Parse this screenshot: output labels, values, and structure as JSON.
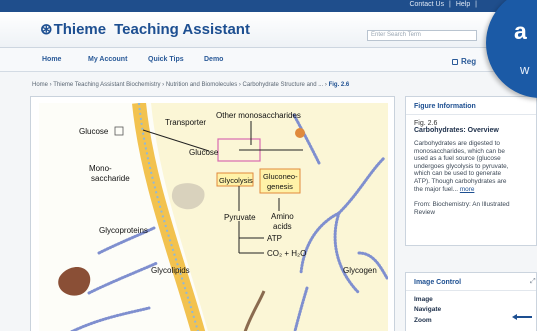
{
  "topbar": {
    "links": [
      "Contact Us",
      "|",
      "Help",
      "|"
    ]
  },
  "header": {
    "brand": "Thieme",
    "brand_icon": "thieme-logo-icon",
    "product": "Teaching Assistant",
    "search_placeholder": "Enter Search Term"
  },
  "nav": {
    "items": [
      "Home",
      "My Account",
      "Quick Tips",
      "Demo"
    ],
    "register": "Reg"
  },
  "breadcrumb": {
    "path": "Home › Thieme Teaching Assistant Biochemistry › Nutrition and Biomolecules › Carbohydrate Structure and ... › ",
    "current": "Fig. 2.6"
  },
  "figure": {
    "labels": {
      "glucose": "Glucose",
      "transporter": "Transporter",
      "other_mono": "Other monosaccharides",
      "mono1": "Mono-",
      "mono2": "saccharide",
      "glucose_inner": "Glucose",
      "glycolysis": "Glycolysis",
      "gluconeo1": "Gluconeo-",
      "gluconeo2": "genesis",
      "pyruvate": "Pyruvate",
      "amino1": "Amino",
      "amino2": "acids",
      "atp": "ATP",
      "co2": "CO₂ + H₂O",
      "glycoproteins": "Glycoproteins",
      "glycolipids": "Glycolipids",
      "glycogen": "Glycogen"
    },
    "colors": {
      "membrane": "#f2c24f",
      "cytoplasm": "#fbf6d6",
      "chain": "#7f8fcf",
      "box_pink": "#d86ab0",
      "box_orange": "#e08a3c",
      "protein": "#8a4f36"
    }
  },
  "panel": {
    "title": "Figure Information",
    "fig": "Fig. 2.6",
    "fig_title": "Carbohydrates: Overview",
    "desc_lines": [
      "Carbohydrates are digested to",
      "monosaccharides, which can be",
      "used as a fuel source (glucose",
      "undergoes glycolysis to pyruvate,",
      "which can be used to generate",
      "ATP). Though carbohydrates are",
      "the major fuel..."
    ],
    "more": "more",
    "from_lines": [
      "From: Biochemistry: An Illustrated",
      "Review"
    ]
  },
  "control": {
    "title": "Image Control",
    "image": "Image",
    "navigate": "Navigate",
    "zoom": "Zoom",
    "expand_icon": "expand-icon",
    "arrow_icon": "navigate-arrow-icon"
  },
  "banner": {
    "big": "a",
    "small": "w"
  }
}
